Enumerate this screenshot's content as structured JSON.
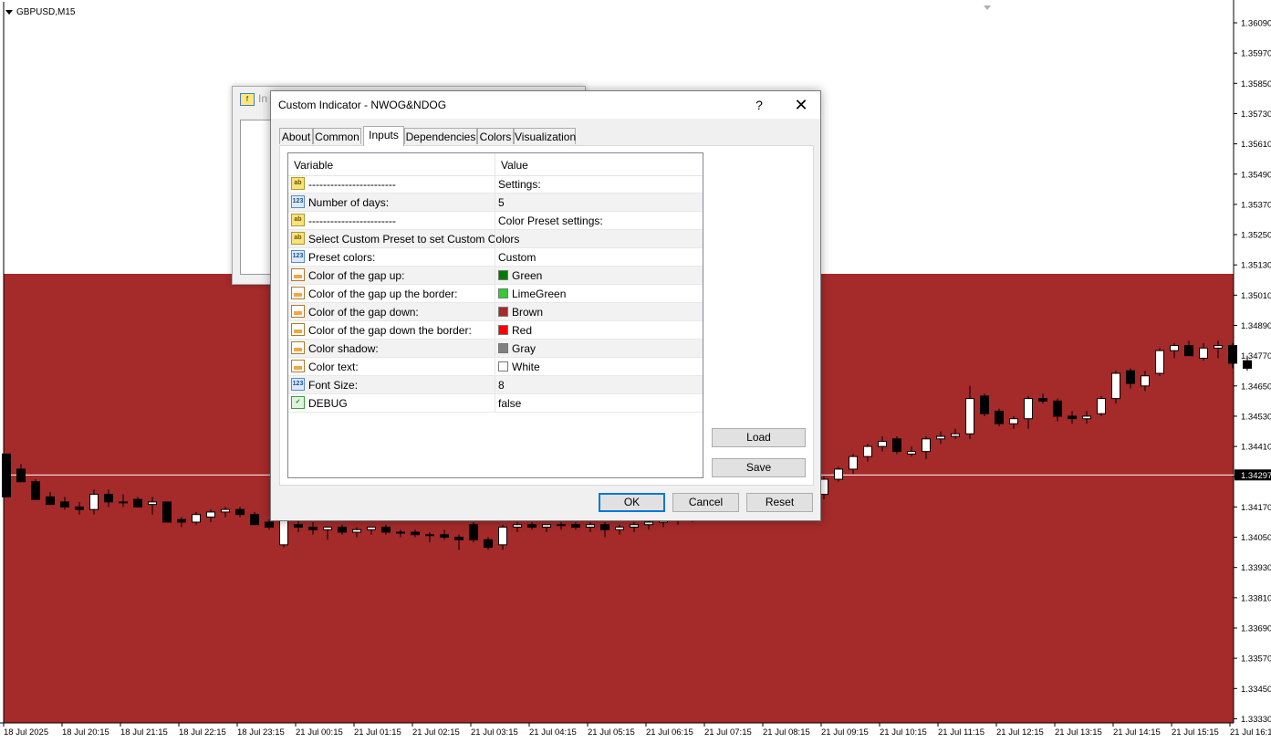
{
  "chart": {
    "symbol": "GBPUSD,M15",
    "price_labels": [
      "1.36090",
      "1.35970",
      "1.35850",
      "1.35730",
      "1.35610",
      "1.35490",
      "1.35370",
      "1.35250",
      "1.35130",
      "1.35010",
      "1.34890",
      "1.34770",
      "1.34650",
      "1.34530",
      "1.34410",
      "1.34290",
      "1.34170",
      "1.34050",
      "1.33930",
      "1.33810",
      "1.33690",
      "1.33570",
      "1.33450",
      "1.33330"
    ],
    "current_price": "1.34297",
    "time_labels": [
      "18 Jul 2025",
      "18 Jul 20:15",
      "18 Jul 21:15",
      "18 Jul 22:15",
      "18 Jul 23:15",
      "21 Jul 00:15",
      "21 Jul 01:15",
      "21 Jul 02:15",
      "21 Jul 03:15",
      "21 Jul 04:15",
      "21 Jul 05:15",
      "21 Jul 06:15",
      "21 Jul 07:15",
      "21 Jul 08:15",
      "21 Jul 09:15",
      "21 Jul 10:15",
      "21 Jul 11:15",
      "21 Jul 12:15",
      "21 Jul 13:15",
      "21 Jul 14:15",
      "21 Jul 15:15",
      "21 Jul 16:15"
    ],
    "colors": {
      "gap_zone": "#a52a2a",
      "background": "#ffffff",
      "bull": "#ffffff",
      "bear": "#000000",
      "price_line": "#ffffff"
    },
    "candles": [
      [
        1.3438,
        1.3433,
        1.3427,
        1.3421
      ],
      [
        1.3432,
        1.3434,
        1.3428,
        1.3427
      ],
      [
        1.3427,
        1.3428,
        1.3422,
        1.342
      ],
      [
        1.3421,
        1.3423,
        1.3418,
        1.3418
      ],
      [
        1.3419,
        1.3421,
        1.3416,
        1.3417
      ],
      [
        1.3417,
        1.3419,
        1.3414,
        1.3416
      ],
      [
        1.3416,
        1.3424,
        1.3414,
        1.3422
      ],
      [
        1.3422,
        1.3424,
        1.3417,
        1.3419
      ],
      [
        1.3419,
        1.3422,
        1.3417,
        1.3419
      ],
      [
        1.342,
        1.3421,
        1.3417,
        1.3417
      ],
      [
        1.3418,
        1.3421,
        1.3414,
        1.3419
      ],
      [
        1.3419,
        1.3419,
        1.3411,
        1.3411
      ],
      [
        1.3412,
        1.3413,
        1.3409,
        1.3411
      ],
      [
        1.3411,
        1.3415,
        1.341,
        1.3414
      ],
      [
        1.3413,
        1.3416,
        1.3411,
        1.3415
      ],
      [
        1.3415,
        1.3417,
        1.3413,
        1.3416
      ],
      [
        1.3416,
        1.3417,
        1.3413,
        1.3414
      ],
      [
        1.3414,
        1.3415,
        1.341,
        1.341
      ],
      [
        1.3411,
        1.3412,
        1.3408,
        1.3409
      ],
      [
        1.3402,
        1.3412,
        1.3401,
        1.3412
      ],
      [
        1.341,
        1.3413,
        1.3407,
        1.3409
      ],
      [
        1.3409,
        1.3411,
        1.3406,
        1.3408
      ],
      [
        1.3408,
        1.3409,
        1.3404,
        1.3409
      ],
      [
        1.3409,
        1.341,
        1.3406,
        1.3407
      ],
      [
        1.3407,
        1.3409,
        1.3405,
        1.3408
      ],
      [
        1.3408,
        1.3409,
        1.3406,
        1.3409
      ],
      [
        1.3409,
        1.341,
        1.3406,
        1.3407
      ],
      [
        1.3407,
        1.3408,
        1.3405,
        1.3407
      ],
      [
        1.3407,
        1.3408,
        1.3405,
        1.3406
      ],
      [
        1.3406,
        1.3407,
        1.3403,
        1.3406
      ],
      [
        1.3406,
        1.3408,
        1.3404,
        1.3405
      ],
      [
        1.3405,
        1.3406,
        1.34,
        1.3404
      ],
      [
        1.341,
        1.3411,
        1.3403,
        1.3404
      ],
      [
        1.3404,
        1.3405,
        1.34,
        1.3401
      ],
      [
        1.3402,
        1.341,
        1.34,
        1.3409
      ],
      [
        1.3409,
        1.3411,
        1.3407,
        1.341
      ],
      [
        1.341,
        1.3411,
        1.3408,
        1.3409
      ],
      [
        1.3409,
        1.341,
        1.3407,
        1.341
      ],
      [
        1.341,
        1.3411,
        1.3408,
        1.341
      ],
      [
        1.341,
        1.3411,
        1.3408,
        1.3409
      ],
      [
        1.3409,
        1.3411,
        1.3407,
        1.341
      ],
      [
        1.341,
        1.3411,
        1.3405,
        1.3408
      ],
      [
        1.3408,
        1.341,
        1.3406,
        1.3409
      ],
      [
        1.3409,
        1.3411,
        1.3407,
        1.341
      ],
      [
        1.341,
        1.3412,
        1.3408,
        1.3411
      ],
      [
        1.3411,
        1.3413,
        1.3409,
        1.3412
      ],
      [
        1.3412,
        1.3414,
        1.341,
        1.3413
      ],
      [
        1.3413,
        1.3415,
        1.3411,
        1.3414
      ],
      [
        1.3414,
        1.3416,
        1.3412,
        1.3415
      ],
      [
        1.3415,
        1.3417,
        1.3413,
        1.3416
      ],
      [
        1.3416,
        1.3418,
        1.3414,
        1.3417
      ],
      [
        1.3417,
        1.3419,
        1.3415,
        1.3418
      ],
      [
        1.3418,
        1.342,
        1.3416,
        1.3419
      ],
      [
        1.3419,
        1.3421,
        1.3417,
        1.342
      ],
      [
        1.342,
        1.3422,
        1.3418,
        1.3421
      ],
      [
        1.3421,
        1.3423,
        1.3419,
        1.3422
      ],
      [
        1.3422,
        1.3429,
        1.342,
        1.3428
      ],
      [
        1.3428,
        1.3433,
        1.3427,
        1.3432
      ],
      [
        1.3432,
        1.3438,
        1.343,
        1.3437
      ],
      [
        1.3437,
        1.3442,
        1.3435,
        1.3441
      ],
      [
        1.3441,
        1.3445,
        1.3439,
        1.3443
      ],
      [
        1.3444,
        1.3445,
        1.3438,
        1.3439
      ],
      [
        1.3438,
        1.3441,
        1.3437,
        1.3439
      ],
      [
        1.3439,
        1.3445,
        1.3436,
        1.3444
      ],
      [
        1.3444,
        1.3447,
        1.3442,
        1.3445
      ],
      [
        1.3445,
        1.3448,
        1.3444,
        1.3446
      ],
      [
        1.3446,
        1.3465,
        1.3444,
        1.346
      ],
      [
        1.3461,
        1.3462,
        1.3453,
        1.3454
      ],
      [
        1.3455,
        1.3456,
        1.3449,
        1.345
      ],
      [
        1.345,
        1.3453,
        1.3448,
        1.3452
      ],
      [
        1.3452,
        1.3461,
        1.3448,
        1.346
      ],
      [
        1.346,
        1.3462,
        1.3458,
        1.3459
      ],
      [
        1.3459,
        1.346,
        1.3451,
        1.3453
      ],
      [
        1.3453,
        1.3455,
        1.345,
        1.3452
      ],
      [
        1.3452,
        1.3455,
        1.345,
        1.3453
      ],
      [
        1.3454,
        1.3461,
        1.3453,
        1.346
      ],
      [
        1.346,
        1.3471,
        1.3458,
        1.347
      ],
      [
        1.3471,
        1.3472,
        1.3464,
        1.3466
      ],
      [
        1.3465,
        1.3471,
        1.3463,
        1.3469
      ],
      [
        1.347,
        1.348,
        1.3469,
        1.3479
      ],
      [
        1.3479,
        1.3482,
        1.3476,
        1.3481
      ],
      [
        1.3481,
        1.3483,
        1.3477,
        1.3477
      ],
      [
        1.3476,
        1.3482,
        1.3475,
        1.348
      ],
      [
        1.348,
        1.3483,
        1.3476,
        1.3481
      ],
      [
        1.3481,
        1.3482,
        1.3472,
        1.3474
      ],
      [
        1.3475,
        1.3477,
        1.3471,
        1.3472
      ]
    ]
  },
  "back_dialog": {
    "title": "In"
  },
  "dialog": {
    "title": "Custom Indicator - NWOG&NDOG",
    "help": "?",
    "close": "✕",
    "tabs": [
      "About",
      "Common",
      "Inputs",
      "Dependencies",
      "Colors",
      "Visualization"
    ],
    "active_tab": "Inputs",
    "columns": {
      "variable": "Variable",
      "value": "Value"
    },
    "rows": [
      {
        "icon": "ab",
        "variable": "------------------------",
        "value": "Settings:"
      },
      {
        "icon": "num",
        "variable": "Number of days:",
        "value": "5"
      },
      {
        "icon": "ab",
        "variable": "------------------------",
        "value": "Color Preset settings:"
      },
      {
        "icon": "ab",
        "variable": "Select Custom Preset to set Custom Colors",
        "value": ""
      },
      {
        "icon": "num",
        "variable": "Preset colors:",
        "value": "Custom"
      },
      {
        "icon": "color",
        "variable": "Color of the gap up:",
        "value": "Green",
        "swatch": "#007a00"
      },
      {
        "icon": "color",
        "variable": "Color of the gap up the border:",
        "value": "LimeGreen",
        "swatch": "#32cd32"
      },
      {
        "icon": "color",
        "variable": "Color of the gap down:",
        "value": "Brown",
        "swatch": "#a52a2a"
      },
      {
        "icon": "color",
        "variable": "Color of the gap down the border:",
        "value": "Red",
        "swatch": "#ff0000"
      },
      {
        "icon": "color",
        "variable": "Color shadow:",
        "value": "Gray",
        "swatch": "#808080"
      },
      {
        "icon": "color",
        "variable": "Color text:",
        "value": "White",
        "swatch": "#ffffff"
      },
      {
        "icon": "num",
        "variable": "Font Size:",
        "value": "8"
      },
      {
        "icon": "bool",
        "variable": "DEBUG",
        "value": "false"
      }
    ],
    "buttons": {
      "load": "Load",
      "save": "Save",
      "ok": "OK",
      "cancel": "Cancel",
      "reset": "Reset"
    }
  }
}
